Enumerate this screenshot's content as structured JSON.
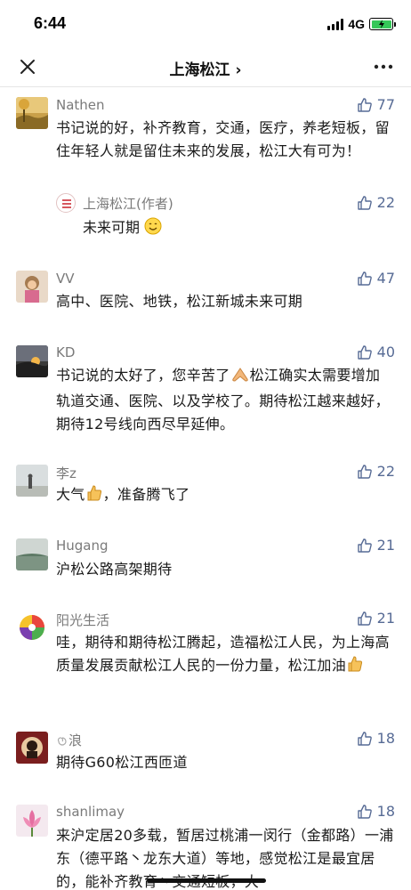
{
  "status": {
    "time": "6:44",
    "network": "4G"
  },
  "nav": {
    "title": "上海松江 ›",
    "close_icon": "close-icon",
    "more_icon": "more-icon"
  },
  "comments": [
    {
      "name": "Nathen",
      "likes": "77",
      "text": "书记说的好，补齐教育，交通，医疗，养老短板，留住年轻人就是留住未来的发展，松江大有可为！",
      "reply": {
        "name": "上海松江(作者)",
        "likes": "22",
        "text": "未来可期"
      }
    },
    {
      "name": "VV",
      "likes": "47",
      "text": "高中、医院、地铁，松江新城未来可期"
    },
    {
      "name": "KD",
      "likes": "40",
      "text_a": "书记说的太好了，您辛苦了",
      "text_b": "松江确实太需要增加轨道交通、医院、以及学校了。期待松江越来越好，期待12号线向西尽早延伸。"
    },
    {
      "name": "李z",
      "likes": "22",
      "text_a": "大气",
      "text_b": "，准备腾飞了"
    },
    {
      "name": "Hugang",
      "likes": "21",
      "text": "沪松公路高架期待"
    },
    {
      "name": "阳光生活",
      "likes": "21",
      "text": "哇，期待和期待松江腾起，造福松江人民，为上海高质量发展贡献松江人民的一份力量，松江加油"
    },
    {
      "name": "浪",
      "likes": "18",
      "text": "期待G60松江西匝道"
    },
    {
      "name": "shanlimay",
      "likes": "18",
      "text": "来沪定居20多载，暂居过桃浦一闵行（金都路）一浦东（德平路丶龙东大道）等地，感觉松江是最宜居的，能补齐教育丶交通短板，大"
    }
  ]
}
